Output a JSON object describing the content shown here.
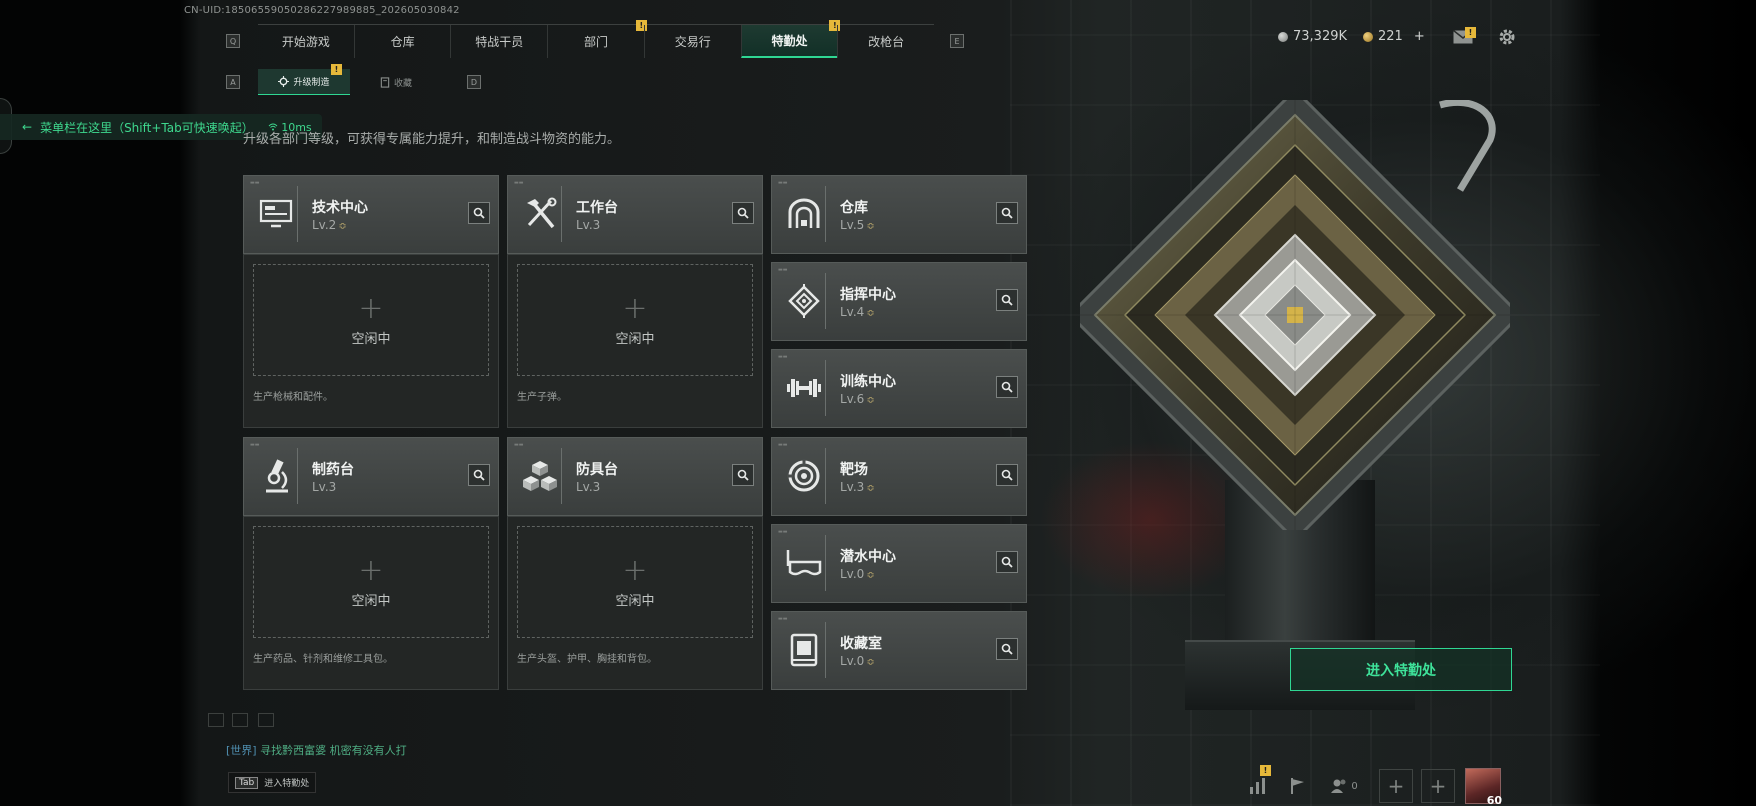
{
  "uid": "CN-UID:18506559050286227989885_202605030842",
  "nav": {
    "left_key": "Q",
    "right_key": "E",
    "tabs": [
      {
        "label": "开始游戏",
        "badge": ""
      },
      {
        "label": "仓库",
        "badge": ""
      },
      {
        "label": "特战干员",
        "badge": ""
      },
      {
        "label": "部门",
        "badge": "!"
      },
      {
        "label": "交易行",
        "badge": ""
      },
      {
        "label": "特勤处",
        "badge": "!",
        "active": true
      },
      {
        "label": "改枪台",
        "badge": ""
      }
    ]
  },
  "subnav": {
    "left_key": "A",
    "right_key": "D",
    "tabs": [
      {
        "label": "升级制造",
        "badge": "!",
        "active": true
      },
      {
        "label": "收藏",
        "badge": ""
      }
    ]
  },
  "resources": {
    "currency1": "73,329K",
    "currency2": "221",
    "plus": "+"
  },
  "menu_hint": {
    "text": "菜单栏在这里（Shift+Tab可快速唤起）",
    "ping": "10ms"
  },
  "description": "升级各部门等级，可获得专属能力提升，和制造战斗物资的能力。",
  "production": [
    {
      "name": "技术中心",
      "level": "Lv.2",
      "up": "≎",
      "idle": "空闲中",
      "plus": "+",
      "desc": "生产枪械和配件。",
      "icon": "monitor-icon"
    },
    {
      "name": "工作台",
      "level": "Lv.3",
      "up": "",
      "idle": "空闲中",
      "plus": "+",
      "desc": "生产子弹。",
      "icon": "tools-icon"
    },
    {
      "name": "制药台",
      "level": "Lv.3",
      "up": "",
      "idle": "空闲中",
      "plus": "+",
      "desc": "生产药品、针剂和维修工具包。",
      "icon": "microscope-icon"
    },
    {
      "name": "防具台",
      "level": "Lv.3",
      "up": "",
      "idle": "空闲中",
      "plus": "+",
      "desc": "生产头盔、护甲、胸挂和背包。",
      "icon": "cubes-icon"
    }
  ],
  "facilities": [
    {
      "name": "仓库",
      "level": "Lv.5",
      "up": "≎",
      "icon": "vault-icon"
    },
    {
      "name": "指挥中心",
      "level": "Lv.4",
      "up": "≎",
      "icon": "command-icon"
    },
    {
      "name": "训练中心",
      "level": "Lv.6",
      "up": "≎",
      "icon": "dumbbell-icon"
    },
    {
      "name": "靶场",
      "level": "Lv.3",
      "up": "≎",
      "icon": "target-icon"
    },
    {
      "name": "潜水中心",
      "level": "Lv.0",
      "up": "≎",
      "icon": "diving-mask-icon"
    },
    {
      "name": "收藏室",
      "level": "Lv.0",
      "up": "≎",
      "icon": "collection-icon"
    }
  ],
  "enter_button": "进入特勤处",
  "chat": {
    "channel": "[世界]",
    "text": "寻找黔西富婆 机密有没有人打"
  },
  "tab_hint": {
    "key": "Tab",
    "label": "进入特勤处"
  },
  "bottom": {
    "friends_count": "0",
    "level": "60",
    "badge": "!",
    "plus": "+"
  },
  "colors": {
    "accent": "#2fd793",
    "badge": "#e6b83a",
    "bg": "#1a1d1d"
  }
}
